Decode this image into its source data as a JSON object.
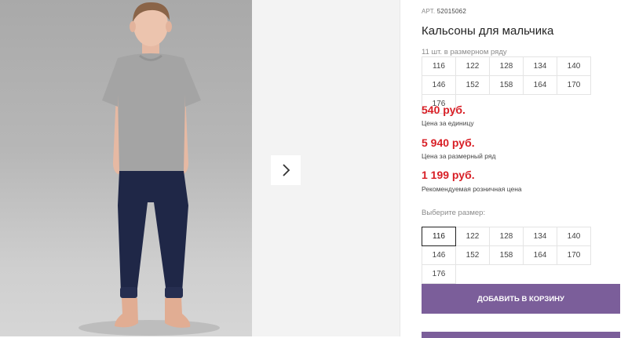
{
  "product": {
    "article_label": "АРТ.",
    "article": "52015062",
    "title": "Кальсоны для мальчика",
    "pack_note": "11 шт. в размерном ряду",
    "pack_sizes": [
      "116",
      "122",
      "128",
      "134",
      "140",
      "146",
      "152",
      "158",
      "164",
      "170",
      "176"
    ]
  },
  "prices": [
    {
      "value": "540 руб.",
      "label": "Цена за единицу"
    },
    {
      "value": "5 940 руб.",
      "label": "Цена за размерный ряд"
    },
    {
      "value": "1 199 руб.",
      "label": "Рекомендуемая розничная цена"
    }
  ],
  "size_picker": {
    "label": "Выберите размер:",
    "sizes": [
      "116",
      "122",
      "128",
      "134",
      "140",
      "146",
      "152",
      "158",
      "164",
      "170",
      "176"
    ],
    "selected": "116"
  },
  "actions": {
    "add_to_cart": "ДОБАВИТЬ В КОРЗИНУ"
  },
  "colors": {
    "price": "#d81f26",
    "button": "#7b5e9a",
    "gallery_bg": "#f3f3f3"
  },
  "icons": {
    "next": "chevron-right-icon"
  }
}
